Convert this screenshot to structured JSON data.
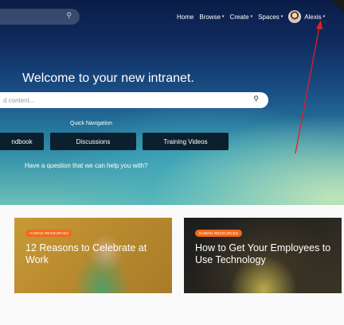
{
  "nav": {
    "search_icon": "search-icon",
    "items": [
      {
        "label": "Home",
        "has_caret": false
      },
      {
        "label": "Browse",
        "has_caret": true
      },
      {
        "label": "Create",
        "has_caret": true
      },
      {
        "label": "Spaces",
        "has_caret": true
      }
    ],
    "user": {
      "name": "Alexis",
      "caret": "▾"
    },
    "caret_glyph": "▾"
  },
  "hero": {
    "welcome": "Welcome to your new intranet.",
    "search_placeholder": "d content...",
    "search_icon_glyph": "🔍",
    "quick_nav_label": "Quick Navigation",
    "quick_links": {
      "handbook": "ndbook",
      "discussions": "Discussions",
      "training": "Training Videos"
    },
    "question": "Have a question that we can help you with?"
  },
  "cards": [
    {
      "tag": "HUMAN RESOURCES",
      "title": "12 Reasons to Celebrate at Work"
    },
    {
      "tag": "HUMAN RESOURCES",
      "title": "How to Get Your Employees to Use Technology"
    }
  ],
  "colors": {
    "tag": "#f26a1b",
    "quick_button": "#0b1f2e",
    "annotation_arrow": "#e02020"
  }
}
